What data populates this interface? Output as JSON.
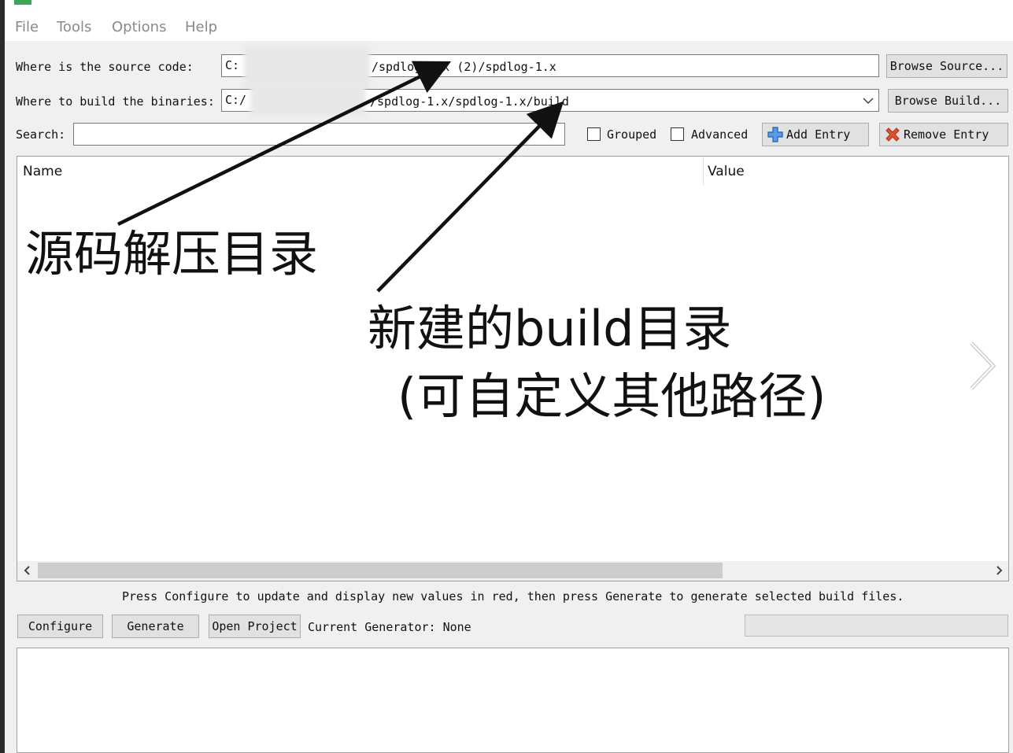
{
  "menu": [
    "File",
    "Tools",
    "Options",
    "Help"
  ],
  "source": {
    "label": "Where is the source code:",
    "value_left": "C:",
    "value_right": "/spdlog-1.x (2)/spdlog-1.x",
    "browse_label": "Browse Source..."
  },
  "build": {
    "label": "Where to build the binaries:",
    "value_left": "C:/",
    "value_right": "/spdlog-1.x/spdlog-1.x/build",
    "browse_label": "Browse Build..."
  },
  "search": {
    "label": "Search:",
    "value": ""
  },
  "options": {
    "grouped_label": "Grouped",
    "advanced_label": "Advanced",
    "grouped_checked": false,
    "advanced_checked": false
  },
  "entries": {
    "add_label": "Add Entry",
    "remove_label": "Remove Entry"
  },
  "table": {
    "name_header": "Name",
    "value_header": "Value"
  },
  "annotations": {
    "source_note": "源码解压目录",
    "build_note_line1": "新建的build目录",
    "build_note_line2": "(可自定义其他路径)"
  },
  "status_text": "Press Configure to update and display new values in red, then press Generate to generate selected build files.",
  "actions": {
    "configure_label": "Configure",
    "generate_label": "Generate",
    "open_project_label": "Open Project",
    "current_generator_text": "Current Generator: None"
  },
  "icons": {
    "add": "plus-icon",
    "remove": "x-icon",
    "combo": "chevron-down-icon",
    "scroll_left": "chevron-left-icon",
    "scroll_right": "chevron-right-icon",
    "page_next": "chevron-right-icon"
  },
  "colors": {
    "add_icon": "#2f7fd8",
    "remove_icon": "#e0522d",
    "app_icon": "#3aa657"
  }
}
